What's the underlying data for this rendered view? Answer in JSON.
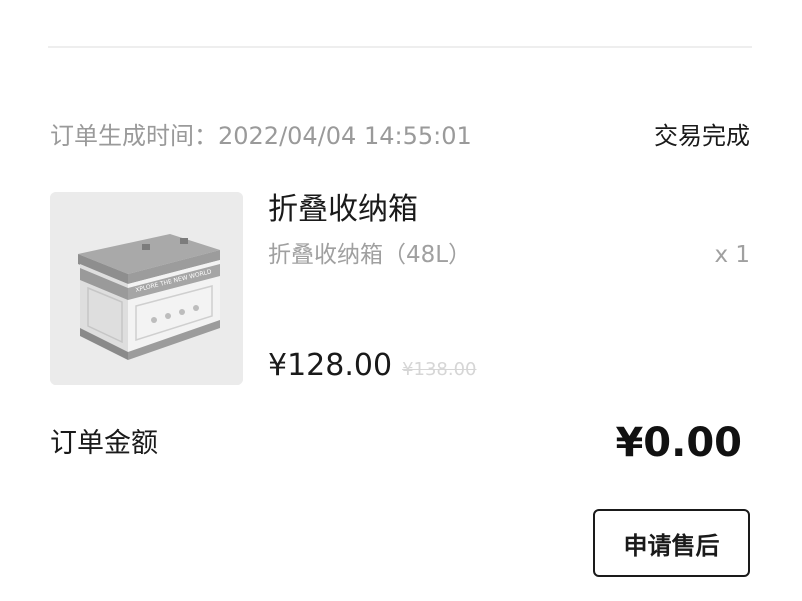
{
  "order": {
    "time_label": "订单生成时间：",
    "time_value": "2022/04/04 14:55:01",
    "status": "交易完成"
  },
  "product": {
    "image_icon": "storage-box-image",
    "box_print": "XPLORE THE NEW WORLD",
    "title": "折叠收纳箱",
    "spec": "折叠收纳箱（48L）",
    "quantity": "x 1",
    "price": "¥128.00",
    "original_price": "¥138.00"
  },
  "total": {
    "label": "订单金额",
    "amount": "¥0.00"
  },
  "actions": {
    "after_sale_label": "申请售后"
  }
}
